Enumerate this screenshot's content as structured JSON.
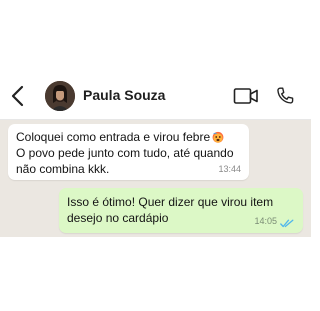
{
  "header": {
    "contact_name": "Paula Souza",
    "back_icon": "chevron-left-icon",
    "video_icon": "video-camera-icon",
    "call_icon": "phone-icon"
  },
  "messages": [
    {
      "direction": "incoming",
      "text": "Coloquei como entrada e virou febre",
      "emoji": "hot-face-emoji",
      "text_cont": "O povo pede junto com tudo, até quando\nnão combina kkk.",
      "time": "13:44"
    },
    {
      "direction": "outgoing",
      "text": "Isso é ótimo! Quer dizer que virou item\ndesejo no cardápio",
      "time": "14:05",
      "status": "read"
    }
  ],
  "colors": {
    "chat_background": "#ebe7e1",
    "outgoing_bubble": "#dcf8c6",
    "incoming_bubble": "#ffffff",
    "read_ticks": "#4fb6ec"
  }
}
